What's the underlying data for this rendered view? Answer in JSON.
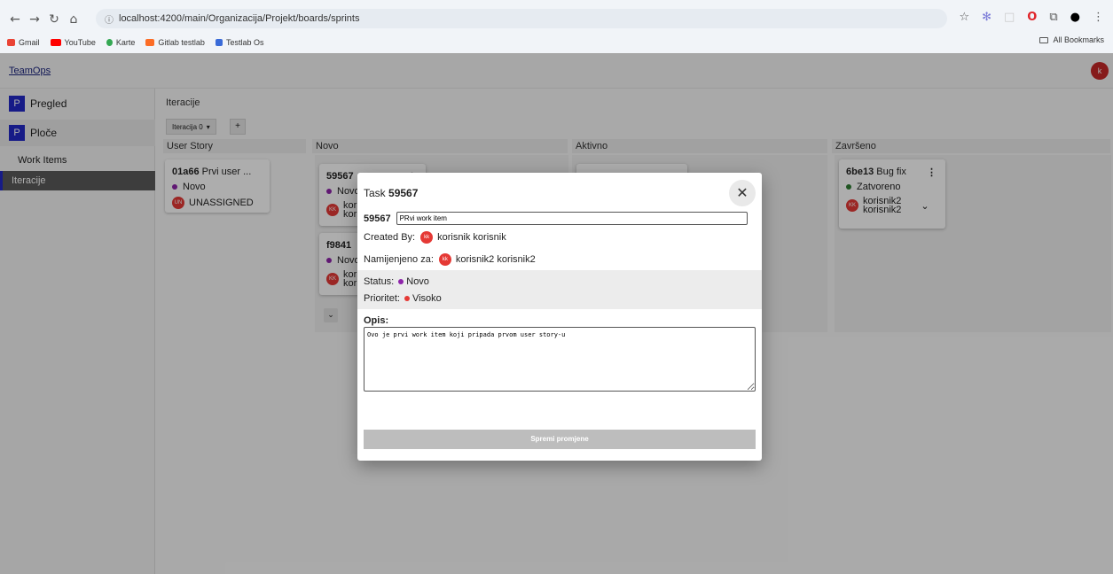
{
  "browser": {
    "url": "localhost:4200/main/Organizacija/Projekt/boards/sprints",
    "bookmarks": [
      "Gmail",
      "YouTube",
      "Karte",
      "Gitlab testlab",
      "Testlab Os"
    ],
    "all_bookmarks": "All Bookmarks"
  },
  "app": {
    "brand": "TeamOps",
    "user_initial": "k"
  },
  "sidebar": {
    "items": [
      {
        "badge": "P",
        "label": "Pregled"
      },
      {
        "badge": "P",
        "label": "Ploče"
      }
    ],
    "subitems": [
      "Work Items",
      "Iteracije"
    ]
  },
  "main": {
    "title": "Iteracije",
    "iteration_select": "Iteracija 0",
    "add_label": "+",
    "columns": [
      "User Story",
      "Novo",
      "Aktivno",
      "Završeno"
    ]
  },
  "cards": {
    "user_story": {
      "id": "01a66",
      "title": "Prvi user ...",
      "status": "Novo",
      "assignee_badge": "UN",
      "assignee": "UNASSIGNED"
    },
    "novo1": {
      "id": "59567",
      "status": "Novo",
      "assignee_badge": "KK",
      "assignee_line1": "kori",
      "assignee_line2": "kori"
    },
    "novo2": {
      "id": "f9841",
      "status": "Novo",
      "assignee_badge": "KK",
      "assignee_line1": "kori",
      "assignee_line2": "kori"
    },
    "zavrseno": {
      "id": "6be13",
      "title": "Bug fix",
      "status": "Zatvoreno",
      "assignee_badge": "KK",
      "assignee_line1": "korisnik2",
      "assignee_line2": "korisnik2"
    }
  },
  "modal": {
    "title_prefix": "Task",
    "title_id": "59567",
    "item_id": "59567",
    "item_title": "PRvi work item",
    "created_by_label": "Created By:",
    "created_by_badge": "kk",
    "created_by": "korisnik korisnik",
    "assigned_label": "Namijenjeno za:",
    "assigned_badge": "kk",
    "assigned_to": "korisnik2 korisnik2",
    "status_label": "Status:",
    "status": "Novo",
    "priority_label": "Prioritet:",
    "priority": "Visoko",
    "description_label": "Opis:",
    "description": "Ovo je prvi work item koji pripada prvom user story-u",
    "save_label": "Spremi promjene"
  },
  "colors": {
    "accent_blue": "#2329c8",
    "status_novo": "#8e24aa",
    "status_zatvoreno": "#2e7d32",
    "priority_visoko": "#e53935",
    "avatar_red": "#e53935"
  }
}
